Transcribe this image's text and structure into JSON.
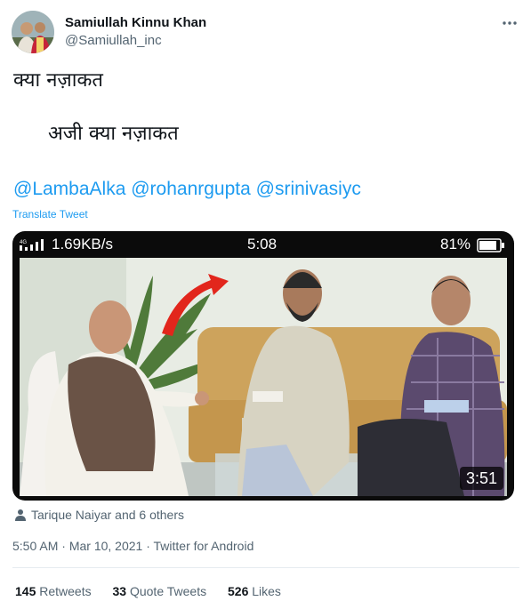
{
  "author": {
    "display_name": "Samiullah Kinnu Khan",
    "handle": "@Samiullah_inc"
  },
  "tweet": {
    "line1": "क्या नज़ाकत",
    "line2": "अजी क्या नज़ाकत",
    "mentions": [
      "@LambaAlka",
      "@rohanrgupta",
      "@srinivasiyc"
    ],
    "translate_label": "Translate Tweet"
  },
  "media": {
    "status_bar": {
      "network": "1.69KB/s",
      "time": "5:08",
      "battery": "81%"
    },
    "duration": "3:51"
  },
  "tagged": "Tarique Naiyar and 6 others",
  "meta": {
    "time": "5:50 AM",
    "date": "Mar 10, 2021",
    "source": "Twitter for Android",
    "separator": "·"
  },
  "stats": {
    "retweets_count": "145",
    "retweets_label": "Retweets",
    "quote_count": "33",
    "quote_label": "Quote Tweets",
    "likes_count": "526",
    "likes_label": "Likes"
  }
}
